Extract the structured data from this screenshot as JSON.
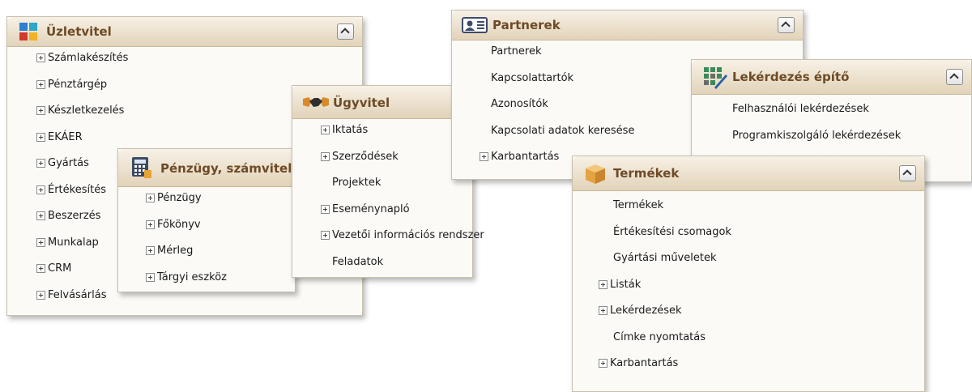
{
  "panels": {
    "uzletvitel": {
      "title": "Üzletvitel",
      "icon": "business-grid-icon",
      "items": [
        "Számlakészítés",
        "Pénztárgép",
        "Készletkezelés",
        "EKÁER",
        "Gyártás",
        "Értékesítés",
        "Beszerzés",
        "Munkalap",
        "CRM",
        "Felvásárlás"
      ]
    },
    "penzugy": {
      "title": "Pénzügy, számvitel",
      "icon": "calculator-icon",
      "items": [
        "Pénzügy",
        "Főkönyv",
        "Mérleg",
        "Tárgyi eszköz"
      ]
    },
    "ugyvitel": {
      "title": "Ügyvitel",
      "icon": "handshake-icon",
      "items": [
        "Iktatás",
        "Szerződések",
        "Projektek",
        "Eseménynapló",
        "Vezetői információs rendszer",
        "Feladatok"
      ]
    },
    "partnerek": {
      "title": "Partnerek",
      "icon": "contact-card-icon",
      "items": [
        "Partnerek",
        "Kapcsolattartók",
        "Azonosítók",
        "Kapcsolati adatok keresése",
        "Karbantartás"
      ]
    },
    "lekerdezes": {
      "title": "Lekérdezés építő",
      "icon": "query-builder-icon",
      "items": [
        "Felhasználói lekérdezések",
        "Programkiszolgáló lekérdezések"
      ]
    },
    "termekek": {
      "title": "Termékek",
      "icon": "product-box-icon",
      "items": [
        "Termékek",
        "Értékesítési csomagok",
        "Gyártási műveletek",
        "Listák",
        "Lekérdezések",
        "Címke nyomtatás",
        "Karbantartás"
      ]
    }
  }
}
